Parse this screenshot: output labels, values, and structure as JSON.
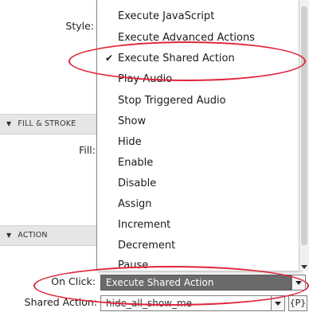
{
  "style_row": {
    "label": "Style:"
  },
  "fill_stroke": {
    "header": "FILL & STROKE",
    "fill_label": "Fill:"
  },
  "action_section": {
    "header": "ACTION"
  },
  "on_click": {
    "label": "On Click:",
    "value": "Execute Shared Action"
  },
  "shared_action": {
    "label": "Shared Action:",
    "value": "hide_all_show_me",
    "p_button": "{P}"
  },
  "dropdown": {
    "items": [
      {
        "label": "Execute JavaScript",
        "checked": false
      },
      {
        "label": "Execute Advanced Actions",
        "checked": false
      },
      {
        "label": "Execute Shared Action",
        "checked": true
      },
      {
        "label": "Play Audio",
        "checked": false
      },
      {
        "label": "Stop Triggered Audio",
        "checked": false
      },
      {
        "label": "Show",
        "checked": false
      },
      {
        "label": "Hide",
        "checked": false
      },
      {
        "label": "Enable",
        "checked": false
      },
      {
        "label": "Disable",
        "checked": false
      },
      {
        "label": "Assign",
        "checked": false
      },
      {
        "label": "Increment",
        "checked": false
      },
      {
        "label": "Decrement",
        "checked": false
      },
      {
        "label": "Pause",
        "checked": false
      }
    ],
    "check_glyph": "✔"
  },
  "colors": {
    "annotation": "#e0243a",
    "selected_bar": "#6a6a6a"
  }
}
